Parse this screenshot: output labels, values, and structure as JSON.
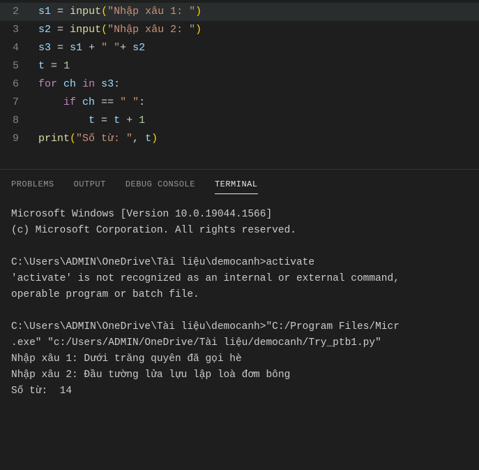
{
  "editor": {
    "lines": [
      {
        "num": "2",
        "tokens": [
          [
            "s1",
            "var"
          ],
          [
            " ",
            "op"
          ],
          [
            "=",
            "op"
          ],
          [
            " ",
            "op"
          ],
          [
            "input",
            "func"
          ],
          [
            "(",
            "paren"
          ],
          [
            "\"Nhập xâu 1: \"",
            "str"
          ],
          [
            ")",
            "paren"
          ]
        ],
        "highlighted": true
      },
      {
        "num": "3",
        "tokens": [
          [
            "s2",
            "var"
          ],
          [
            " ",
            "op"
          ],
          [
            "=",
            "op"
          ],
          [
            " ",
            "op"
          ],
          [
            "input",
            "func"
          ],
          [
            "(",
            "paren"
          ],
          [
            "\"Nhập xâu 2: \"",
            "str"
          ],
          [
            ")",
            "paren"
          ]
        ]
      },
      {
        "num": "4",
        "tokens": [
          [
            "s3",
            "var"
          ],
          [
            " ",
            "op"
          ],
          [
            "=",
            "op"
          ],
          [
            " ",
            "op"
          ],
          [
            "s1",
            "var"
          ],
          [
            " ",
            "op"
          ],
          [
            "+",
            "op"
          ],
          [
            " ",
            "op"
          ],
          [
            "\" \"",
            "str"
          ],
          [
            "+",
            "op"
          ],
          [
            " ",
            "op"
          ],
          [
            "s2",
            "var"
          ]
        ]
      },
      {
        "num": "5",
        "tokens": [
          [
            "t",
            "var"
          ],
          [
            " ",
            "op"
          ],
          [
            "=",
            "op"
          ],
          [
            " ",
            "op"
          ],
          [
            "1",
            "num"
          ]
        ]
      },
      {
        "num": "6",
        "tokens": [
          [
            "for",
            "kw"
          ],
          [
            " ",
            "op"
          ],
          [
            "ch",
            "var"
          ],
          [
            " ",
            "op"
          ],
          [
            "in",
            "kw"
          ],
          [
            " ",
            "op"
          ],
          [
            "s3",
            "var"
          ],
          [
            ":",
            "op"
          ]
        ]
      },
      {
        "num": "7",
        "tokens": [
          [
            "    ",
            "op"
          ],
          [
            "if",
            "kw"
          ],
          [
            " ",
            "op"
          ],
          [
            "ch",
            "var"
          ],
          [
            " ",
            "op"
          ],
          [
            "==",
            "op"
          ],
          [
            " ",
            "op"
          ],
          [
            "\" \"",
            "str"
          ],
          [
            ":",
            "op"
          ]
        ]
      },
      {
        "num": "8",
        "tokens": [
          [
            "        ",
            "op"
          ],
          [
            "t",
            "var"
          ],
          [
            " ",
            "op"
          ],
          [
            "=",
            "op"
          ],
          [
            " ",
            "op"
          ],
          [
            "t",
            "var"
          ],
          [
            " ",
            "op"
          ],
          [
            "+",
            "op"
          ],
          [
            " ",
            "op"
          ],
          [
            "1",
            "num"
          ]
        ]
      },
      {
        "num": "9",
        "tokens": [
          [
            "print",
            "func"
          ],
          [
            "(",
            "paren"
          ],
          [
            "\"Số từ: \"",
            "str"
          ],
          [
            ",",
            "op"
          ],
          [
            " ",
            "op"
          ],
          [
            "t",
            "var"
          ],
          [
            ")",
            "paren"
          ]
        ]
      }
    ]
  },
  "panel": {
    "tabs": [
      {
        "label": "PROBLEMS",
        "active": false
      },
      {
        "label": "OUTPUT",
        "active": false
      },
      {
        "label": "DEBUG CONSOLE",
        "active": false
      },
      {
        "label": "TERMINAL",
        "active": true
      }
    ]
  },
  "terminal": {
    "blocks": [
      "Microsoft Windows [Version 10.0.19044.1566]\n(c) Microsoft Corporation. All rights reserved.",
      "C:\\Users\\ADMIN\\OneDrive\\Tài liệu\\democanh>activate\n'activate' is not recognized as an internal or external command,\noperable program or batch file.",
      "C:\\Users\\ADMIN\\OneDrive\\Tài liệu\\democanh>\"C:/Program Files/Micr\n.exe\" \"c:/Users/ADMIN/OneDrive/Tài liệu/democanh/Try_ptb1.py\"\nNhập xâu 1: Dưới trăng quyên đã gọi hè\nNhập xâu 2: Đầu tường lửa lựu lập loà đơm bông\nSố từ:  14"
    ]
  }
}
